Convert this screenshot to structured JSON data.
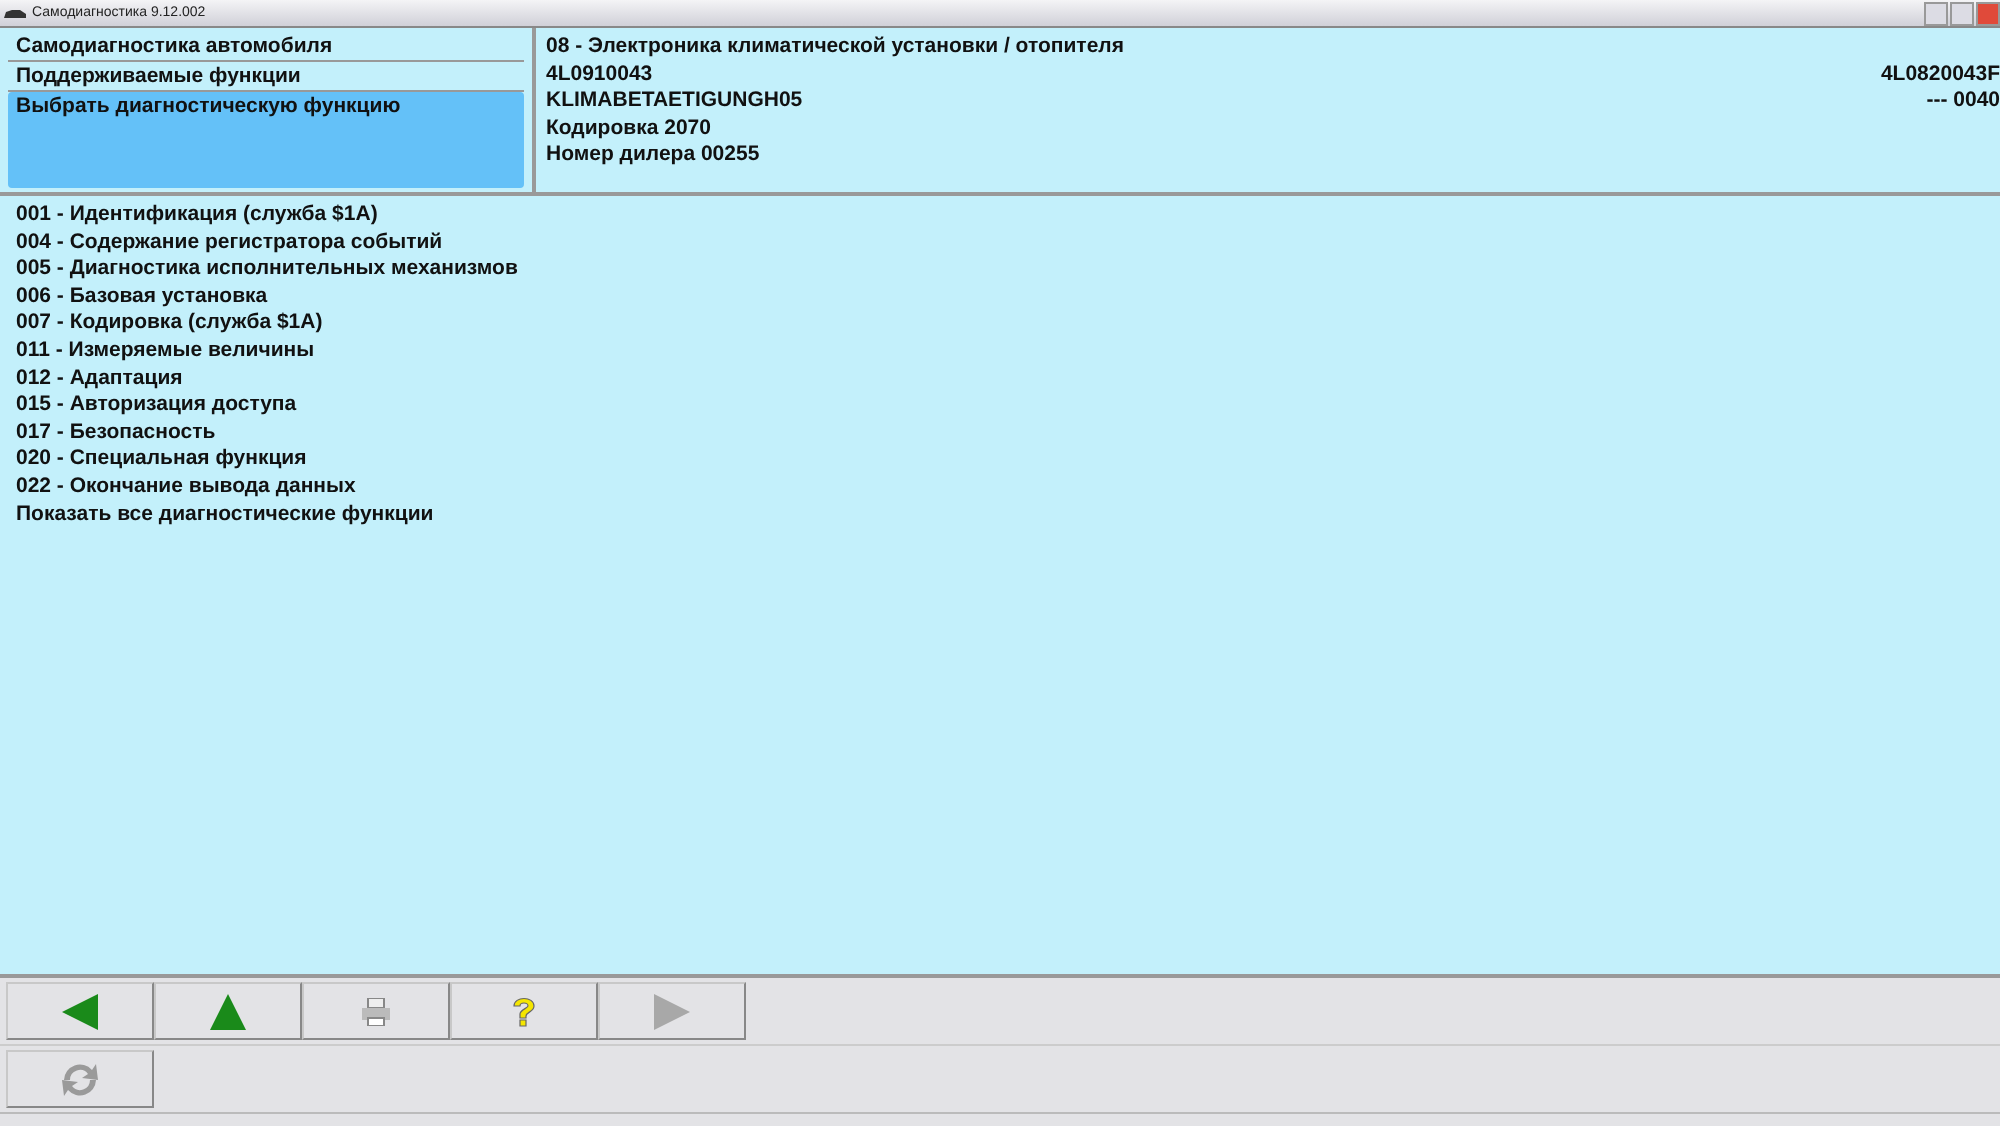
{
  "window": {
    "title": "Самодиагностика 9.12.002"
  },
  "nav": [
    {
      "label": "Самодиагностика автомобиля",
      "selected": false
    },
    {
      "label": "Поддерживаемые функции",
      "selected": false
    },
    {
      "label": "Выбрать диагностическую функцию",
      "selected": true
    }
  ],
  "info": [
    {
      "left": "08 - Электроника климатической установки / отопителя"
    },
    {
      "left": "4L0910043",
      "right": "4L0820043F"
    },
    {
      "left": "KLIMABETAETIGUNGH05",
      "right": "--- 0040"
    },
    {
      "left": "Кодировка 2070"
    },
    {
      "left": "Номер дилера 00255"
    }
  ],
  "functions": [
    "001 - Идентификация (служба $1A)",
    "004 - Содержание регистратора событий",
    "005 - Диагностика исполнительных механизмов",
    "006 - Базовая установка",
    "007 - Кодировка (служба $1A)",
    "011 - Измеряемые величины",
    "012 - Адаптация",
    "015 - Авторизация доступа",
    "017 - Безопасность",
    "020 - Специальная функция",
    "022 - Окончание вывода данных",
    "Показать все диагностические функции"
  ],
  "toolbar": [
    {
      "kind": "back",
      "disabled": false
    },
    {
      "kind": "up",
      "disabled": false
    },
    {
      "kind": "print",
      "disabled": true
    },
    {
      "kind": "help",
      "disabled": false
    },
    {
      "kind": "forward",
      "disabled": true
    }
  ],
  "toolbar2": [
    {
      "kind": "refresh",
      "disabled": true
    }
  ]
}
